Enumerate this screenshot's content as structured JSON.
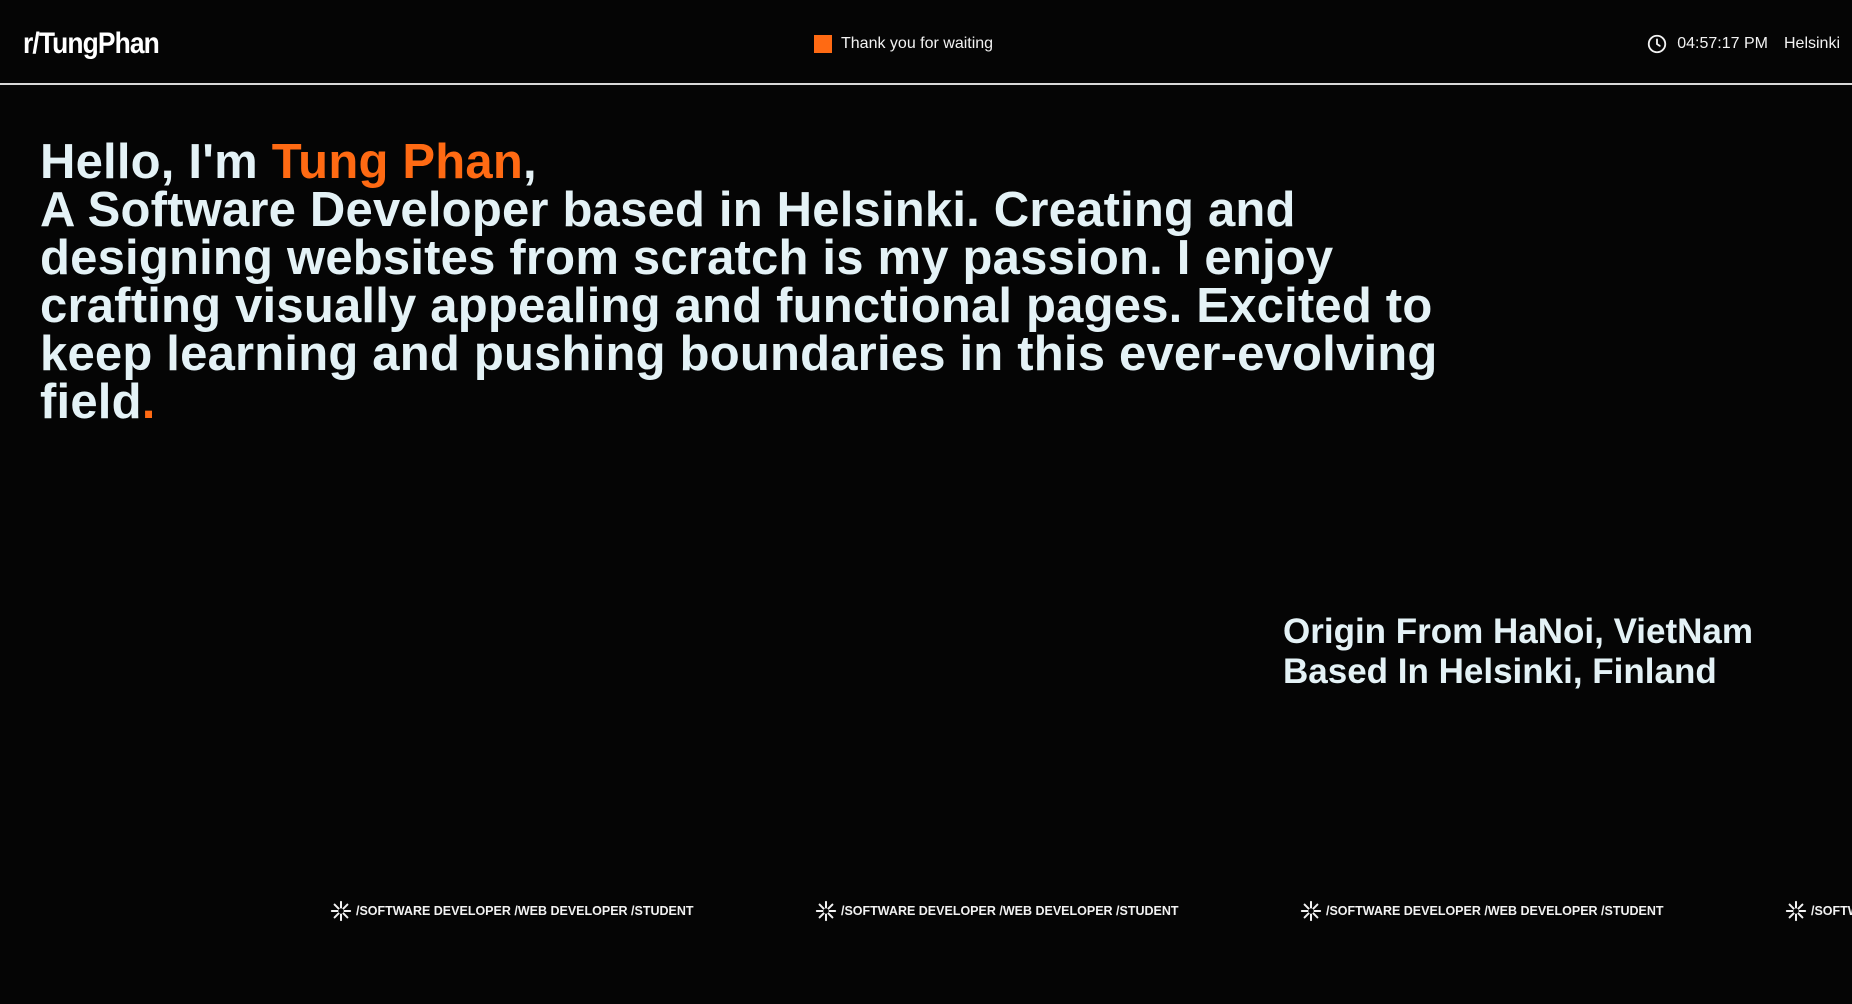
{
  "header": {
    "logo": "r/TungPhan",
    "status_text": "Thank you for waiting",
    "time": "04:57:17 PM",
    "city": "Helsinki"
  },
  "hero": {
    "greeting": "Hello, I'm ",
    "name": "Tung Phan",
    "comma": ",",
    "bio": "A Software Developer based in Helsinki. Creating and designing websites from scratch is my passion. I enjoy crafting visually appealing and functional pages. Excited to keep learning and pushing boundaries in this ever-evolving field",
    "period": "."
  },
  "origin": {
    "line1": "Origin From HaNoi, VietNam",
    "line2": "Based In Helsinki, Finland"
  },
  "marquee": {
    "text": "/SOFTWARE DEVELOPER /WEB DEVELOPER /STUDENT",
    "icon": "asterisk-icon"
  },
  "colors": {
    "accent": "#ff6a13",
    "background": "#050505",
    "text": "#e4f2f6"
  }
}
